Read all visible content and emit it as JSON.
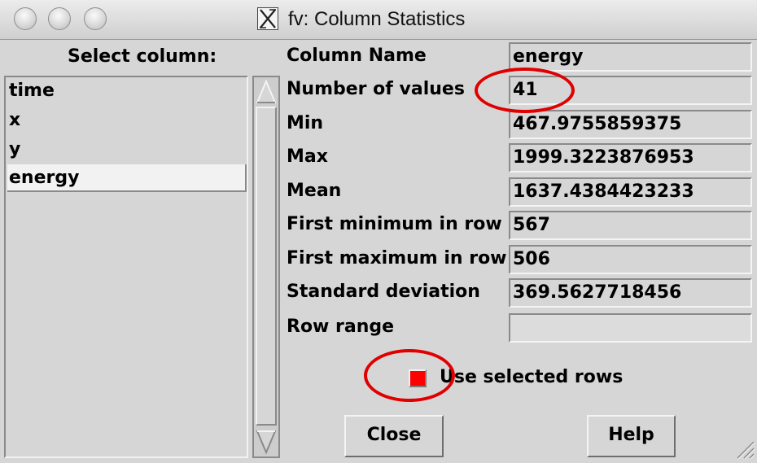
{
  "window": {
    "title": "fv: Column Statistics",
    "window_buttons": [
      "close-button",
      "minimize-button",
      "zoom-button"
    ]
  },
  "column_list": {
    "header": "Select column:",
    "items": [
      "time",
      "x",
      "y",
      "energy"
    ],
    "selected": "energy"
  },
  "stats": [
    {
      "label": "Column Name",
      "value": "energy"
    },
    {
      "label": "Number of values",
      "value": "41"
    },
    {
      "label": "Min",
      "value": "467.9755859375"
    },
    {
      "label": "Max",
      "value": "1999.3223876953"
    },
    {
      "label": "Mean",
      "value": "1637.4384423233"
    },
    {
      "label": "First minimum in row",
      "value": "567"
    },
    {
      "label": "First maximum in row",
      "value": "506"
    },
    {
      "label": "Standard deviation",
      "value": "369.5627718456"
    },
    {
      "label": "Row range",
      "value": ""
    }
  ],
  "options": {
    "use_selected_rows_label": "Use selected rows",
    "use_selected_rows_checked": true
  },
  "buttons": {
    "close_label": "Close",
    "help_label": "Help"
  },
  "colors": {
    "checkbox_fill": "#ff0000",
    "annotation": "#e00000",
    "window_bg": "#d6d6d6"
  }
}
